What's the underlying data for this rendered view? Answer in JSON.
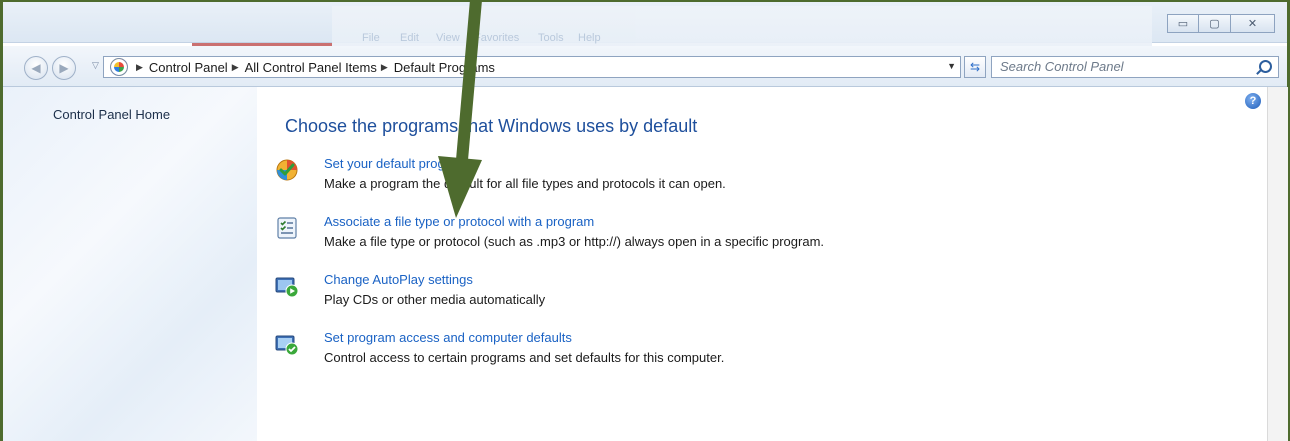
{
  "window": {
    "ghost_menu": [
      "File",
      "Edit",
      "View",
      "Favorites",
      "Tools",
      "Help"
    ],
    "buttons": {
      "minimize": "▭",
      "maximize": "▢",
      "close": "✕"
    }
  },
  "nav": {
    "back_glyph": "◀",
    "forward_glyph": "▶",
    "breadcrumbs": [
      "Control Panel",
      "All Control Panel Items",
      "Default Programs"
    ],
    "search_placeholder": "Search Control Panel"
  },
  "sidebar": {
    "home_link": "Control Panel Home"
  },
  "main": {
    "title": "Choose the programs that Windows uses by default",
    "tasks": [
      {
        "link": "Set your default programs",
        "description": "Make a program the default for all file types and protocols it can open.",
        "icon": "default-programs-icon"
      },
      {
        "link": "Associate a file type or protocol with a program",
        "description": "Make a file type or protocol (such as .mp3 or http://) always open in a specific program.",
        "icon": "file-association-icon"
      },
      {
        "link": "Change AutoPlay settings",
        "description": "Play CDs or other media automatically",
        "icon": "autoplay-icon"
      },
      {
        "link": "Set program access and computer defaults",
        "description": "Control access to certain programs and set defaults for this computer.",
        "icon": "program-access-icon"
      }
    ]
  },
  "help": {
    "label": "?"
  },
  "colors": {
    "frame": "#4e6b2e",
    "arrow": "#4e6b2e",
    "link": "#1a62c4",
    "title": "#1e4f9c"
  }
}
